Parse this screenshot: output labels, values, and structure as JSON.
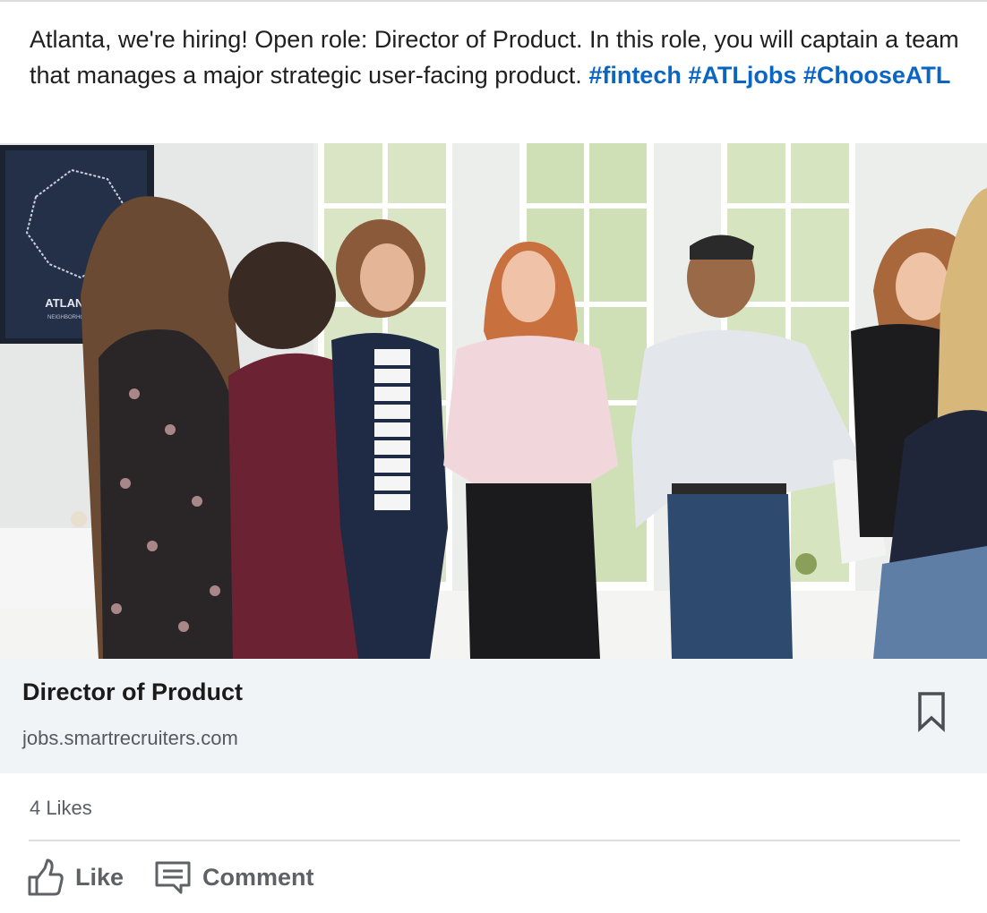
{
  "post": {
    "text_before": "Atlanta, we're hiring! Open role: Director of Product. In this role, you will captain a team that manages a major strategic user-facing product. ",
    "hashtags": [
      "#fintech",
      "#ATLjobs",
      "#ChooseATL"
    ]
  },
  "photo": {
    "poster_text": "ATLANTA",
    "poster_subtext": "NEIGHBORHOODS"
  },
  "link_card": {
    "title": "Director of Product",
    "domain": "jobs.smartrecruiters.com",
    "bookmark_icon": "bookmark-icon"
  },
  "social": {
    "likes": "4 Likes"
  },
  "actions": {
    "like_label": "Like",
    "like_icon": "thumbs-up-icon",
    "comment_label": "Comment",
    "comment_icon": "comment-icon"
  },
  "colors": {
    "hashtag": "#0a66c2",
    "card_background": "#f1f4f6",
    "action_text": "#5e6266"
  }
}
